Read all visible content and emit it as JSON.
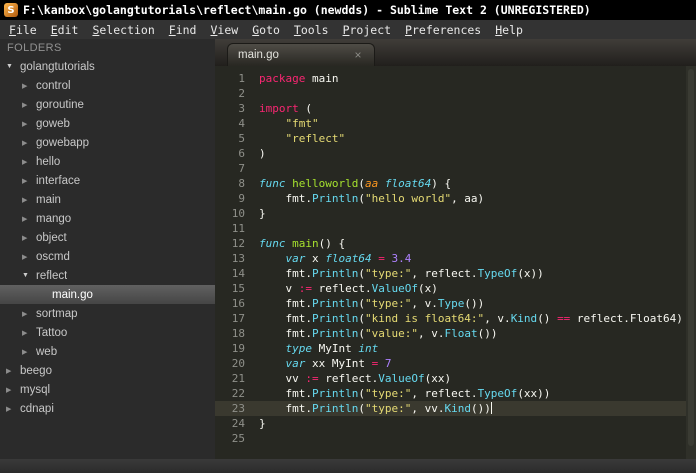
{
  "window": {
    "title": "F:\\kanbox\\golangtutorials\\reflect\\main.go (newdds) - Sublime Text 2 (UNREGISTERED)",
    "app_icon_glyph": "S"
  },
  "menu": {
    "items": [
      {
        "label": "File",
        "accel": "F"
      },
      {
        "label": "Edit",
        "accel": "E"
      },
      {
        "label": "Selection",
        "accel": "S"
      },
      {
        "label": "Find",
        "accel": "F"
      },
      {
        "label": "View",
        "accel": "V"
      },
      {
        "label": "Goto",
        "accel": "G"
      },
      {
        "label": "Tools",
        "accel": "T"
      },
      {
        "label": "Project",
        "accel": "P"
      },
      {
        "label": "Preferences",
        "accel": "P"
      },
      {
        "label": "Help",
        "accel": "H"
      }
    ]
  },
  "sidebar": {
    "header": "FOLDERS",
    "items": [
      {
        "label": "golangtutorials",
        "level": 0,
        "type": "folder",
        "state": "expanded"
      },
      {
        "label": "control",
        "level": 1,
        "type": "folder",
        "state": "collapsed"
      },
      {
        "label": "goroutine",
        "level": 1,
        "type": "folder",
        "state": "collapsed"
      },
      {
        "label": "goweb",
        "level": 1,
        "type": "folder",
        "state": "collapsed"
      },
      {
        "label": "gowebapp",
        "level": 1,
        "type": "folder",
        "state": "collapsed"
      },
      {
        "label": "hello",
        "level": 1,
        "type": "folder",
        "state": "collapsed"
      },
      {
        "label": "interface",
        "level": 1,
        "type": "folder",
        "state": "collapsed"
      },
      {
        "label": "main",
        "level": 1,
        "type": "folder",
        "state": "collapsed"
      },
      {
        "label": "mango",
        "level": 1,
        "type": "folder",
        "state": "collapsed"
      },
      {
        "label": "object",
        "level": 1,
        "type": "folder",
        "state": "collapsed"
      },
      {
        "label": "oscmd",
        "level": 1,
        "type": "folder",
        "state": "collapsed"
      },
      {
        "label": "reflect",
        "level": 1,
        "type": "folder",
        "state": "expanded"
      },
      {
        "label": "main.go",
        "level": 2,
        "type": "file",
        "selected": true
      },
      {
        "label": "sortmap",
        "level": 1,
        "type": "folder",
        "state": "collapsed"
      },
      {
        "label": "Tattoo",
        "level": 1,
        "type": "folder",
        "state": "collapsed"
      },
      {
        "label": "web",
        "level": 1,
        "type": "folder",
        "state": "collapsed"
      },
      {
        "label": "beego",
        "level": 0,
        "type": "folder",
        "state": "collapsed"
      },
      {
        "label": "mysql",
        "level": 0,
        "type": "folder",
        "state": "collapsed"
      },
      {
        "label": "cdnapi",
        "level": 0,
        "type": "folder",
        "state": "collapsed"
      }
    ]
  },
  "editor": {
    "tab": {
      "label": "main.go",
      "close": "×"
    },
    "active_line": 23,
    "lines": [
      {
        "tokens": [
          [
            "kw",
            "package"
          ],
          [
            "pl",
            " main"
          ]
        ]
      },
      {
        "tokens": []
      },
      {
        "tokens": [
          [
            "kw",
            "import"
          ],
          [
            "pl",
            " ("
          ]
        ]
      },
      {
        "tokens": [
          [
            "pl",
            "    "
          ],
          [
            "str",
            "\"fmt\""
          ]
        ]
      },
      {
        "tokens": [
          [
            "pl",
            "    "
          ],
          [
            "str",
            "\"reflect\""
          ]
        ]
      },
      {
        "tokens": [
          [
            "pl",
            ")"
          ]
        ]
      },
      {
        "tokens": []
      },
      {
        "tokens": [
          [
            "sto",
            "func"
          ],
          [
            "pl",
            " "
          ],
          [
            "fn",
            "helloworld"
          ],
          [
            "pl",
            "("
          ],
          [
            "par",
            "aa"
          ],
          [
            "pl",
            " "
          ],
          [
            "ty",
            "float64"
          ],
          [
            "pl",
            ") {"
          ]
        ]
      },
      {
        "tokens": [
          [
            "pl",
            "    fmt."
          ],
          [
            "call",
            "Println"
          ],
          [
            "pl",
            "("
          ],
          [
            "str",
            "\"hello world\""
          ],
          [
            "pl",
            ", aa)"
          ]
        ]
      },
      {
        "tokens": [
          [
            "pl",
            "}"
          ]
        ]
      },
      {
        "tokens": []
      },
      {
        "tokens": [
          [
            "sto",
            "func"
          ],
          [
            "pl",
            " "
          ],
          [
            "fn",
            "main"
          ],
          [
            "pl",
            "() {"
          ]
        ]
      },
      {
        "tokens": [
          [
            "pl",
            "    "
          ],
          [
            "sto",
            "var"
          ],
          [
            "pl",
            " x "
          ],
          [
            "ty",
            "float64"
          ],
          [
            "pl",
            " "
          ],
          [
            "op",
            "="
          ],
          [
            "pl",
            " "
          ],
          [
            "num",
            "3.4"
          ]
        ]
      },
      {
        "tokens": [
          [
            "pl",
            "    fmt."
          ],
          [
            "call",
            "Println"
          ],
          [
            "pl",
            "("
          ],
          [
            "str",
            "\"type:\""
          ],
          [
            "pl",
            ", reflect."
          ],
          [
            "call",
            "TypeOf"
          ],
          [
            "pl",
            "(x))"
          ]
        ]
      },
      {
        "tokens": [
          [
            "pl",
            "    v "
          ],
          [
            "op",
            ":="
          ],
          [
            "pl",
            " reflect."
          ],
          [
            "call",
            "ValueOf"
          ],
          [
            "pl",
            "(x)"
          ]
        ]
      },
      {
        "tokens": [
          [
            "pl",
            "    fmt."
          ],
          [
            "call",
            "Println"
          ],
          [
            "pl",
            "("
          ],
          [
            "str",
            "\"type:\""
          ],
          [
            "pl",
            ", v."
          ],
          [
            "call",
            "Type"
          ],
          [
            "pl",
            "())"
          ]
        ]
      },
      {
        "tokens": [
          [
            "pl",
            "    fmt."
          ],
          [
            "call",
            "Println"
          ],
          [
            "pl",
            "("
          ],
          [
            "str",
            "\"kind is float64:\""
          ],
          [
            "pl",
            ", v."
          ],
          [
            "call",
            "Kind"
          ],
          [
            "pl",
            "() "
          ],
          [
            "op",
            "=="
          ],
          [
            "pl",
            " reflect.Float64)"
          ]
        ]
      },
      {
        "tokens": [
          [
            "pl",
            "    fmt."
          ],
          [
            "call",
            "Println"
          ],
          [
            "pl",
            "("
          ],
          [
            "str",
            "\"value:\""
          ],
          [
            "pl",
            ", v."
          ],
          [
            "call",
            "Float"
          ],
          [
            "pl",
            "())"
          ]
        ]
      },
      {
        "tokens": [
          [
            "pl",
            "    "
          ],
          [
            "sto",
            "type"
          ],
          [
            "pl",
            " MyInt "
          ],
          [
            "ty",
            "int"
          ]
        ]
      },
      {
        "tokens": [
          [
            "pl",
            "    "
          ],
          [
            "sto",
            "var"
          ],
          [
            "pl",
            " xx MyInt "
          ],
          [
            "op",
            "="
          ],
          [
            "pl",
            " "
          ],
          [
            "num",
            "7"
          ]
        ]
      },
      {
        "tokens": [
          [
            "pl",
            "    vv "
          ],
          [
            "op",
            ":="
          ],
          [
            "pl",
            " reflect."
          ],
          [
            "call",
            "ValueOf"
          ],
          [
            "pl",
            "(xx)"
          ]
        ]
      },
      {
        "tokens": [
          [
            "pl",
            "    fmt."
          ],
          [
            "call",
            "Println"
          ],
          [
            "pl",
            "("
          ],
          [
            "str",
            "\"type:\""
          ],
          [
            "pl",
            ", reflect."
          ],
          [
            "call",
            "TypeOf"
          ],
          [
            "pl",
            "(xx))"
          ]
        ]
      },
      {
        "tokens": [
          [
            "pl",
            "    fmt."
          ],
          [
            "call",
            "Println"
          ],
          [
            "pl",
            "("
          ],
          [
            "str",
            "\"type:\""
          ],
          [
            "pl",
            ", vv."
          ],
          [
            "call",
            "Kind"
          ],
          [
            "pl",
            "())"
          ]
        ],
        "cursor": true
      },
      {
        "tokens": [
          [
            "pl",
            "}"
          ]
        ]
      },
      {
        "tokens": []
      }
    ]
  },
  "colors": {
    "editor_bg": "#272822",
    "keyword": "#f92672",
    "storage_type": "#66d9ef",
    "function_name": "#a6e22e",
    "parameter": "#fd971f",
    "string": "#e6db74",
    "number": "#ae81ff",
    "foreground": "#f8f8f2",
    "line_number": "#8f908a",
    "active_line_bg": "#3a392f",
    "titlebar_bg": "#000000",
    "sidebar_bg": "#2b2b2b",
    "selection_bg": "#4f4f4f"
  }
}
